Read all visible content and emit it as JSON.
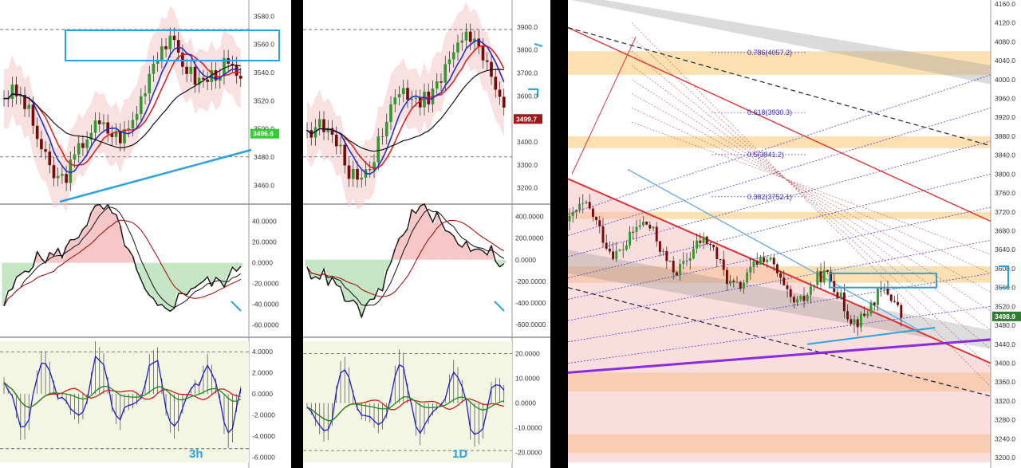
{
  "charts": [
    {
      "id": "p1",
      "timeframe_label": "3h",
      "price_axis": {
        "ticks": [
          "3580.0",
          "3560.0",
          "3540.0",
          "3520.0",
          "3500.0",
          "3480.0",
          "3460.0"
        ],
        "ylim": [
          3450,
          3587
        ]
      },
      "last_price": "3496.6",
      "last_price_color": "#33cc33",
      "osc1_axis": {
        "ticks": [
          "40.0000",
          "20.0000",
          "0.0000",
          "-20.0000",
          "-40.0000",
          "-60.0000"
        ],
        "ylim": [
          -68,
          52
        ]
      },
      "osc2_axis": {
        "ticks": [
          "4.0000",
          "2.0000",
          "0.0000",
          "-2.0000",
          "-4.0000",
          "-6.0000"
        ],
        "ylim": [
          -6.5,
          5
        ]
      }
    },
    {
      "id": "p2",
      "timeframe_label": "1D",
      "price_axis": {
        "ticks": [
          "3900.0",
          "3800.0",
          "3700.0",
          "3600.0",
          "3500.0",
          "3400.0",
          "3300.0",
          "3200.0"
        ],
        "ylim": [
          3150,
          3990
        ]
      },
      "last_price": "3499.7",
      "last_price_color": "#a01818",
      "osc1_axis": {
        "ticks": [
          "400.0000",
          "200.0000",
          "0.0000",
          "-200.0000",
          "-400.0000",
          "-600.0000"
        ],
        "ylim": [
          -680,
          470
        ]
      },
      "osc2_axis": {
        "ticks": [
          "20.0000",
          "10.0000",
          "0.0000",
          "-10.0000",
          "-20.0000"
        ],
        "ylim": [
          -24,
          25
        ]
      }
    },
    {
      "id": "p3",
      "timeframe_label": "",
      "price_axis": {
        "ticks": [
          "4160.0",
          "4120.0",
          "4080.0",
          "4040.0",
          "4000.0",
          "3960.0",
          "3920.0",
          "3880.0",
          "3840.0",
          "3800.0",
          "3760.0",
          "3720.0",
          "3680.0",
          "3640.0",
          "3600.0",
          "3560.0",
          "3520.0",
          "3480.0",
          "3440.0",
          "3400.0",
          "3360.0",
          "3320.0",
          "3280.0",
          "3240.0",
          "3200.0"
        ],
        "ylim": [
          3190,
          4165
        ]
      },
      "last_price": "3498.9",
      "last_price_color": "#2e7d32",
      "fib_levels": [
        {
          "label": "0.786(4057.2)",
          "value": 4057.2
        },
        {
          "label": "0.618(3930.3)",
          "value": 3930.3
        },
        {
          "label": "0.5(3841.2)",
          "value": 3841.2
        },
        {
          "label": "0.382(3752.1)",
          "value": 3752.1
        }
      ]
    }
  ],
  "colors": {
    "bull": "#2e9b2e",
    "bear": "#7a0a0a",
    "trend": "#29a3e0",
    "channel": "#e03030",
    "zone": "#f5a623",
    "fib": "#3a2fc0",
    "support": "#8a2be2"
  }
}
